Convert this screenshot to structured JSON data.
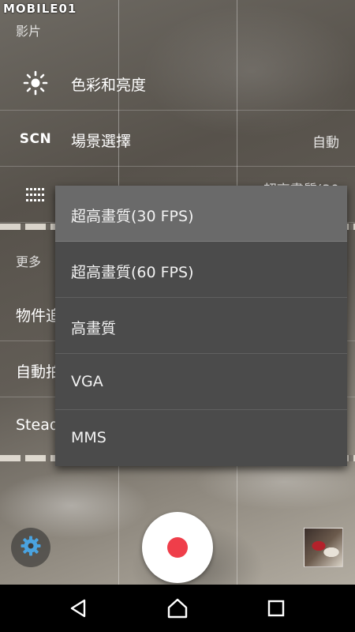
{
  "status_bar": {
    "watermark": "MOBILE01"
  },
  "settings": {
    "video_section_header": "影片",
    "rows": [
      {
        "icon": "brightness-icon",
        "label": "色彩和亮度",
        "value": ""
      },
      {
        "icon": "scn-icon",
        "icon_text": "SCN",
        "label": "場景選擇",
        "value": "自動"
      }
    ],
    "resolution_row": {
      "icon": "grid-dots-icon",
      "value": "超高畫質(30"
    },
    "more_section_header": "更多",
    "more_rows": [
      {
        "label": "物件追"
      },
      {
        "label": "自動拍"
      },
      {
        "label": "Stead"
      }
    ]
  },
  "dropdown": {
    "options": [
      {
        "label": "超高畫質(30 FPS)",
        "selected": true
      },
      {
        "label": "超高畫質(60 FPS)",
        "selected": false
      },
      {
        "label": "高畫質",
        "selected": false
      },
      {
        "label": "VGA",
        "selected": false
      },
      {
        "label": "MMS",
        "selected": false
      }
    ]
  },
  "controls": {
    "settings_icon": "gear-icon",
    "shutter_icon": "record-icon",
    "thumbnail": "gallery-thumbnail"
  },
  "nav": {
    "back": "back-icon",
    "home": "home-icon",
    "recents": "recents-icon"
  },
  "colors": {
    "accent_blue": "#4aa3e0",
    "record_red": "#ef3e4a",
    "menu_bg": "#4b4b4b",
    "menu_selected": "#6a6a6a"
  }
}
